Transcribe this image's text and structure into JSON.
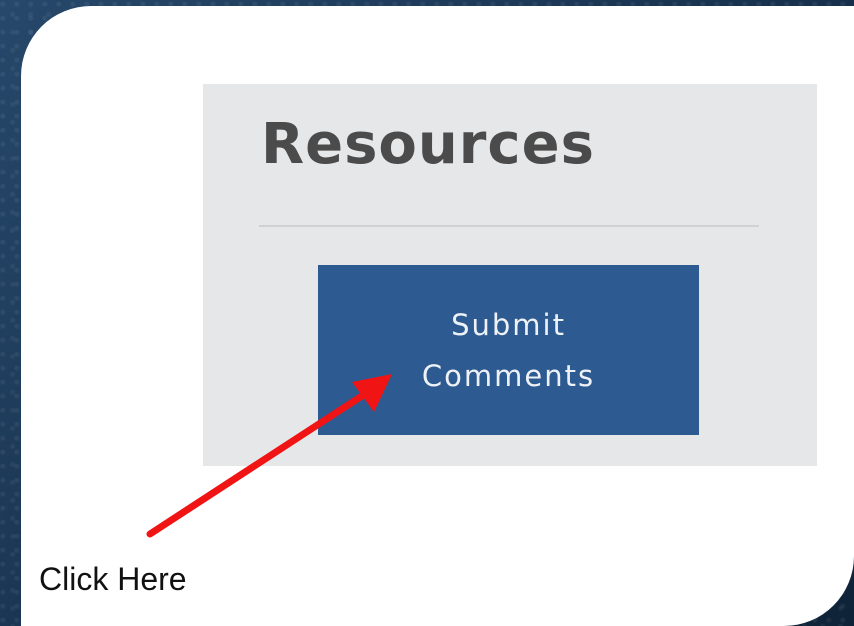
{
  "resources": {
    "title": "Resources",
    "button": {
      "line1": "Submit",
      "line2": "Comments"
    }
  },
  "annotation": {
    "label": "Click Here",
    "arrow_color": "#f01414"
  },
  "colors": {
    "panel_background": "#e6e7e9",
    "button_background": "#2c5a91",
    "title_text": "#4b4b4b",
    "slide_background": "#1f3a57"
  }
}
